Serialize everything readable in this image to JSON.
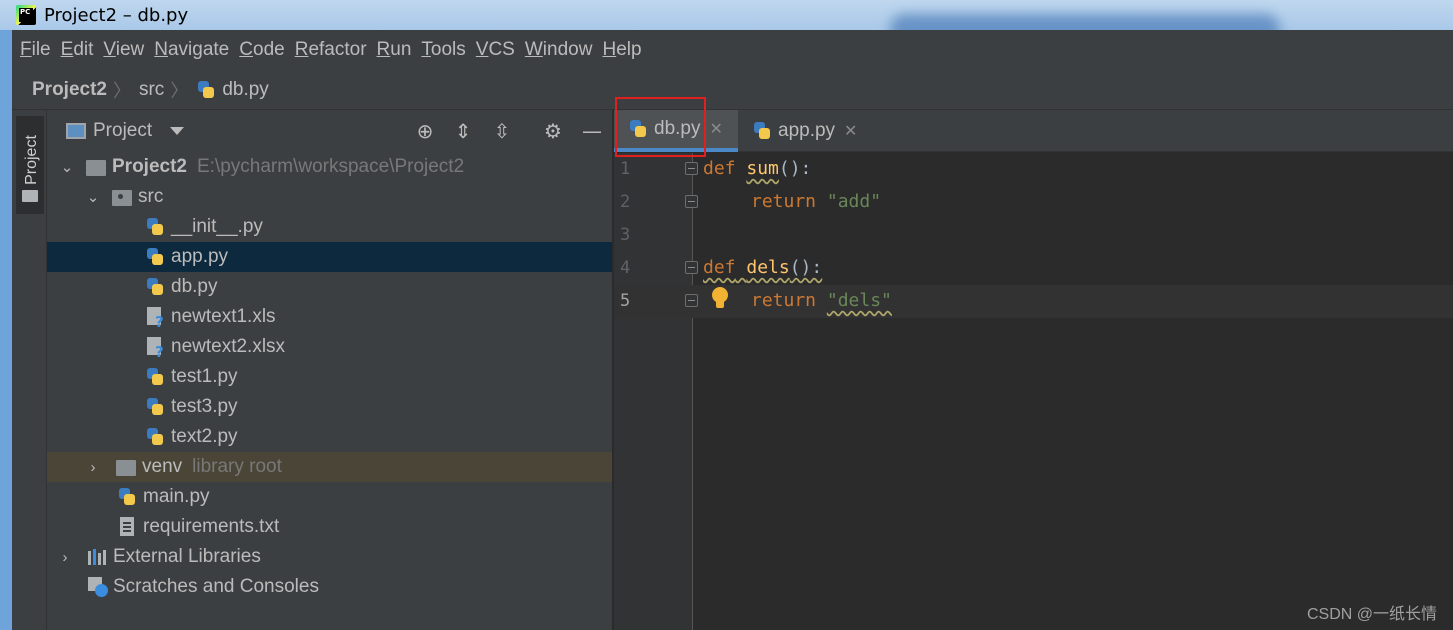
{
  "window": {
    "title": "Project2 – db.py",
    "app_icon_text": "PC"
  },
  "menu": [
    "File",
    "Edit",
    "View",
    "Navigate",
    "Code",
    "Refactor",
    "Run",
    "Tools",
    "VCS",
    "Window",
    "Help"
  ],
  "breadcrumb": [
    "Project2",
    "src",
    "db.py"
  ],
  "tool_stripe": {
    "project_tab": "Project"
  },
  "project_panel": {
    "title": "Project",
    "tree": [
      {
        "label": "Project2",
        "hint": "E:\\pycharm\\workspace\\Project2"
      },
      {
        "label": "src"
      },
      {
        "label": "__init__.py"
      },
      {
        "label": "app.py"
      },
      {
        "label": "db.py"
      },
      {
        "label": "newtext1.xls"
      },
      {
        "label": "newtext2.xlsx"
      },
      {
        "label": "test1.py"
      },
      {
        "label": "test3.py"
      },
      {
        "label": "text2.py"
      },
      {
        "label": "venv",
        "hint": "library root"
      },
      {
        "label": "main.py"
      },
      {
        "label": "requirements.txt"
      },
      {
        "label": "External Libraries"
      },
      {
        "label": "Scratches and Consoles"
      }
    ]
  },
  "tabs": [
    {
      "label": "db.py",
      "active": true
    },
    {
      "label": "app.py",
      "active": false
    }
  ],
  "editor": {
    "line_numbers": [
      "1",
      "2",
      "3",
      "4",
      "5"
    ],
    "current_line": "5",
    "code": {
      "l1_kw": "def",
      "l1_fn": "sum",
      "l1_rest": "():",
      "l2_kw": "return",
      "l2_str": "\"add\"",
      "l4_kw": "def",
      "l4_fn": "dels",
      "l4_rest": "():",
      "l5_kw": "return",
      "l5_str": "\"dels\""
    }
  },
  "watermark": "CSDN @一纸长情",
  "colors": {
    "accent": "#4a88c7",
    "highlight_box": "#e0201f",
    "selection": "#0d293e"
  }
}
